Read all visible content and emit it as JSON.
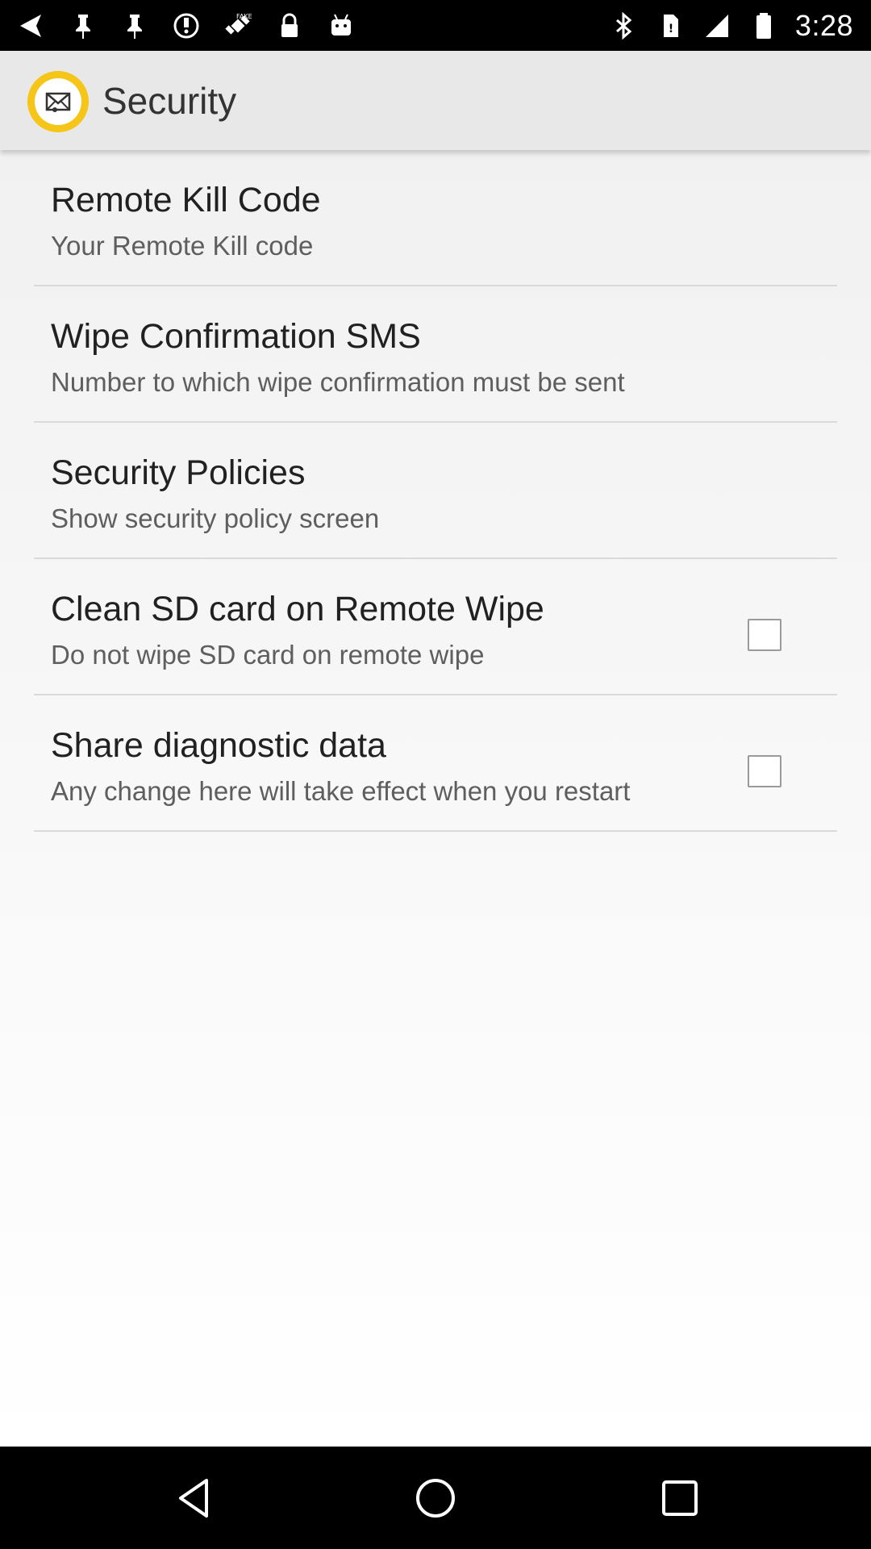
{
  "status_bar": {
    "time": "3:28",
    "left_icons": [
      "back-arrow-notification-icon",
      "pin-icon",
      "pin-icon",
      "alarm-icon",
      "fake-gps-satellite-icon",
      "lock-icon",
      "android-robot-icon"
    ],
    "right_icons": [
      "bluetooth-icon",
      "no-sim-icon",
      "signal-icon",
      "battery-icon"
    ]
  },
  "app_bar": {
    "title": "Security",
    "logo_icon": "mail-shield-icon",
    "logo_color": "#f5c518"
  },
  "preferences": [
    {
      "title": "Remote Kill Code",
      "summary": "Your Remote Kill code",
      "has_checkbox": false
    },
    {
      "title": "Wipe Confirmation SMS",
      "summary": "Number to which wipe confirmation must be sent",
      "has_checkbox": false
    },
    {
      "title": "Security Policies",
      "summary": "Show security policy screen",
      "has_checkbox": false
    },
    {
      "title": "Clean SD card on Remote Wipe",
      "summary": "Do not wipe SD card on remote wipe",
      "has_checkbox": true,
      "checked": false
    },
    {
      "title": "Share diagnostic data",
      "summary": "Any change here will take effect when you restart",
      "has_checkbox": true,
      "checked": false
    }
  ],
  "nav_bar": {
    "buttons": [
      "back-icon",
      "home-icon",
      "recents-icon"
    ]
  }
}
